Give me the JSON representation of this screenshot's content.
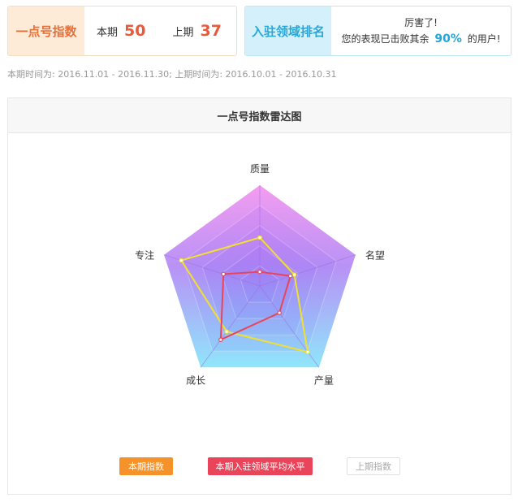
{
  "index_card": {
    "label": "一点号指数",
    "current_label": "本期",
    "current_value": "50",
    "previous_label": "上期",
    "previous_value": "37"
  },
  "rank_card": {
    "label": "入驻领域排名",
    "line1": "厉害了!",
    "line2_prefix": "您的表现已击败其余",
    "percent": "90%",
    "line2_suffix": "的用户!"
  },
  "period_text": "本期时间为: 2016.11.01 - 2016.11.30; 上期时间为: 2016.10.01 - 2016.10.31",
  "chart_data": {
    "type": "radar",
    "title": "一点号指数雷达图",
    "axes": [
      "质量",
      "名望",
      "产量",
      "成长",
      "专注"
    ],
    "max": 100,
    "series": [
      {
        "name": "本期指数",
        "values": [
          48,
          36,
          81,
          56,
          82
        ],
        "color": "#f3e02c"
      },
      {
        "name": "本期入驻领域平均水平",
        "values": [
          14,
          32,
          33,
          66,
          38
        ],
        "color": "#e94459"
      },
      {
        "name": "上期指数",
        "values": [],
        "color": "#cccccc"
      }
    ],
    "legend": [
      {
        "label": "本期指数",
        "color": "#f5922a"
      },
      {
        "label": "本期入驻领域平均水平",
        "color": "#e94459"
      },
      {
        "label": "上期指数",
        "color": "#cccccc"
      }
    ]
  }
}
